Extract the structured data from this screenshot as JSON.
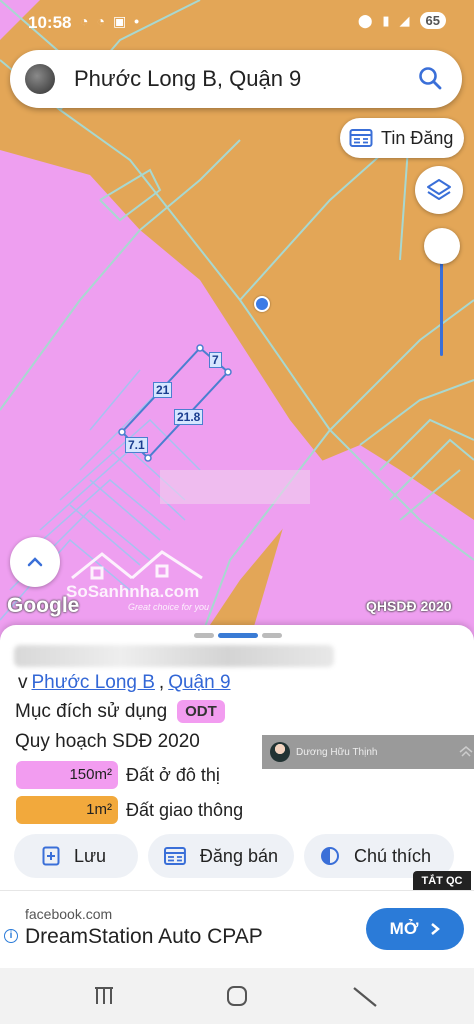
{
  "status_bar": {
    "time": "10:58",
    "left_icons": [
      "messenger-icon",
      "messenger-icon",
      "screen-icon",
      "dot-icon"
    ],
    "right_icons": [
      "location-icon",
      "signal-5g-icon",
      "signal-icon"
    ],
    "battery": "65"
  },
  "search": {
    "query": "Phước Long B, Quận 9"
  },
  "tin_dang": {
    "label": "Tin Đăng"
  },
  "map": {
    "parcel_labels": [
      "7",
      "21",
      "21.8",
      "7.1"
    ],
    "attribution": "Google",
    "layer_tag": "QHSDĐ 2020",
    "watermark_brand": "SoSanhnha.com",
    "watermark_slogan": "Great choice for you",
    "zoom_level": 0.0,
    "colors": {
      "residential": "#ee9ff0",
      "transport": "#e3a657",
      "parcel_outline": "#4a7fd0"
    }
  },
  "sheet": {
    "location_prefix": "v",
    "ward": "Phước Long B",
    "separator": ",",
    "district": "Quận 9",
    "purpose_label": "Mục đích sử dụng",
    "purpose_code": "ODT",
    "plan_title": "Quy hoạch SDĐ 2020",
    "land_uses": [
      {
        "area": "150m²",
        "name": "Đất ở đô thị",
        "color": "#f29cf0"
      },
      {
        "area": "1m²",
        "name": "Đất giao thông",
        "color": "#f2a93c"
      }
    ],
    "owner_name": "Dương Hữu Thịnh",
    "actions": [
      {
        "label": "Lưu",
        "icon": "add-bookmark-icon"
      },
      {
        "label": "Đăng bán",
        "icon": "listing-icon"
      },
      {
        "label": "Chú thích",
        "icon": "contrast-icon"
      }
    ]
  },
  "ad": {
    "close_label": "TẮT QC",
    "source": "facebook.com",
    "title": "DreamStation Auto CPAP",
    "button_label": "MỞ"
  },
  "nav": [
    "recent-apps-icon",
    "home-icon",
    "back-icon"
  ]
}
